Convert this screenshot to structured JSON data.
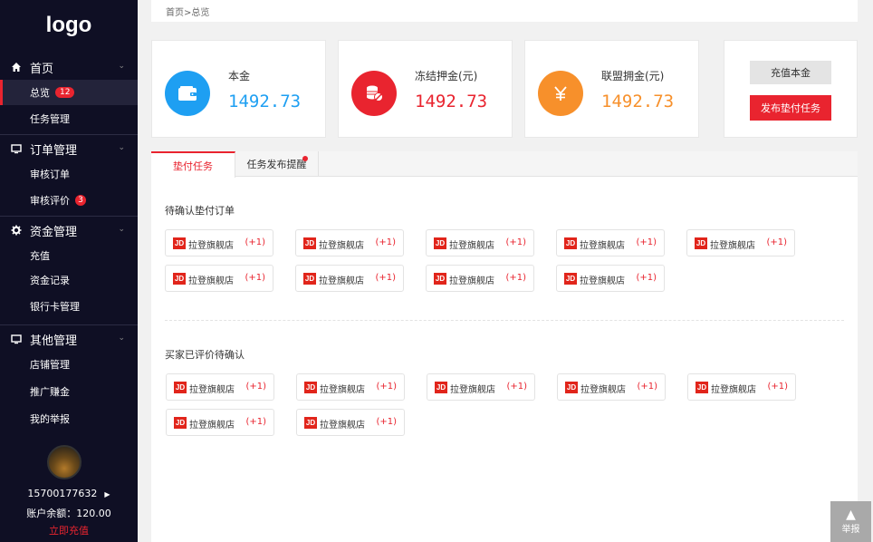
{
  "sidebar": {
    "logo": "logo",
    "groups": [
      {
        "icon": "home-icon",
        "label": "首页",
        "items": [
          {
            "label": "总览",
            "badge": "12",
            "active": true
          },
          {
            "label": "任务管理"
          }
        ]
      },
      {
        "icon": "monitor-icon",
        "label": "订单管理",
        "items": [
          {
            "label": "审核订单"
          },
          {
            "label": "审核评价",
            "badge": "3"
          }
        ]
      },
      {
        "icon": "gear-icon",
        "label": "资金管理",
        "items": [
          {
            "label": "充值"
          },
          {
            "label": "资金记录"
          },
          {
            "label": "银行卡管理"
          }
        ]
      },
      {
        "icon": "monitor-icon",
        "label": "其他管理",
        "items": [
          {
            "label": "店铺管理"
          },
          {
            "label": "推广赚金"
          },
          {
            "label": "我的举报"
          }
        ]
      }
    ],
    "user": {
      "phone": "15700177632",
      "balance": "账户余额：120.00",
      "recharge": "立即充值"
    }
  },
  "breadcrumb": "首页>总览",
  "cards": [
    {
      "label": "本金",
      "value": "1492.73",
      "color": "#1e9ff2",
      "icon": "wallet-icon"
    },
    {
      "label": "冻结押金(元)",
      "value": "1492.73",
      "color": "#e9242f",
      "icon": "coins-icon"
    },
    {
      "label": "联盟拥金(元)",
      "value": "1492.73",
      "color": "#f7902b",
      "icon": "yen-icon"
    }
  ],
  "actions": {
    "recharge_principal": "充值本金",
    "publish_task": "发布垫付任务"
  },
  "tabs": [
    {
      "label": "垫付任务",
      "active": true
    },
    {
      "label": "任务发布提醒",
      "dot": true
    }
  ],
  "sections": [
    {
      "title": "待确认垫付订单",
      "shops": [
        {
          "badge": "JD",
          "name": "拉登旗舰店",
          "plus": "(+1)"
        },
        {
          "badge": "JD",
          "name": "拉登旗舰店",
          "plus": "(+1)"
        },
        {
          "badge": "JD",
          "name": "拉登旗舰店",
          "plus": "(+1)"
        },
        {
          "badge": "JD",
          "name": "拉登旗舰店",
          "plus": "(+1)"
        },
        {
          "badge": "JD",
          "name": "拉登旗舰店",
          "plus": "(+1)"
        },
        {
          "badge": "JD",
          "name": "拉登旗舰店",
          "plus": "(+1)"
        },
        {
          "badge": "JD",
          "name": "拉登旗舰店",
          "plus": "(+1)"
        },
        {
          "badge": "JD",
          "name": "拉登旗舰店",
          "plus": "(+1)"
        },
        {
          "badge": "JD",
          "name": "拉登旗舰店",
          "plus": "(+1)"
        }
      ]
    },
    {
      "title": "买家已评价待确认",
      "shops": [
        {
          "badge": "JD",
          "name": "拉登旗舰店",
          "plus": "(+1)"
        },
        {
          "badge": "JD",
          "name": "拉登旗舰店",
          "plus": "(+1)"
        },
        {
          "badge": "JD",
          "name": "拉登旗舰店",
          "plus": "(+1)"
        },
        {
          "badge": "JD",
          "name": "拉登旗舰店",
          "plus": "(+1)"
        },
        {
          "badge": "JD",
          "name": "拉登旗舰店",
          "plus": "(+1)"
        },
        {
          "badge": "JD",
          "name": "拉登旗舰店",
          "plus": "(+1)"
        },
        {
          "badge": "JD",
          "name": "拉登旗舰店",
          "plus": "(+1)"
        }
      ]
    }
  ],
  "report": {
    "label": "举报"
  }
}
